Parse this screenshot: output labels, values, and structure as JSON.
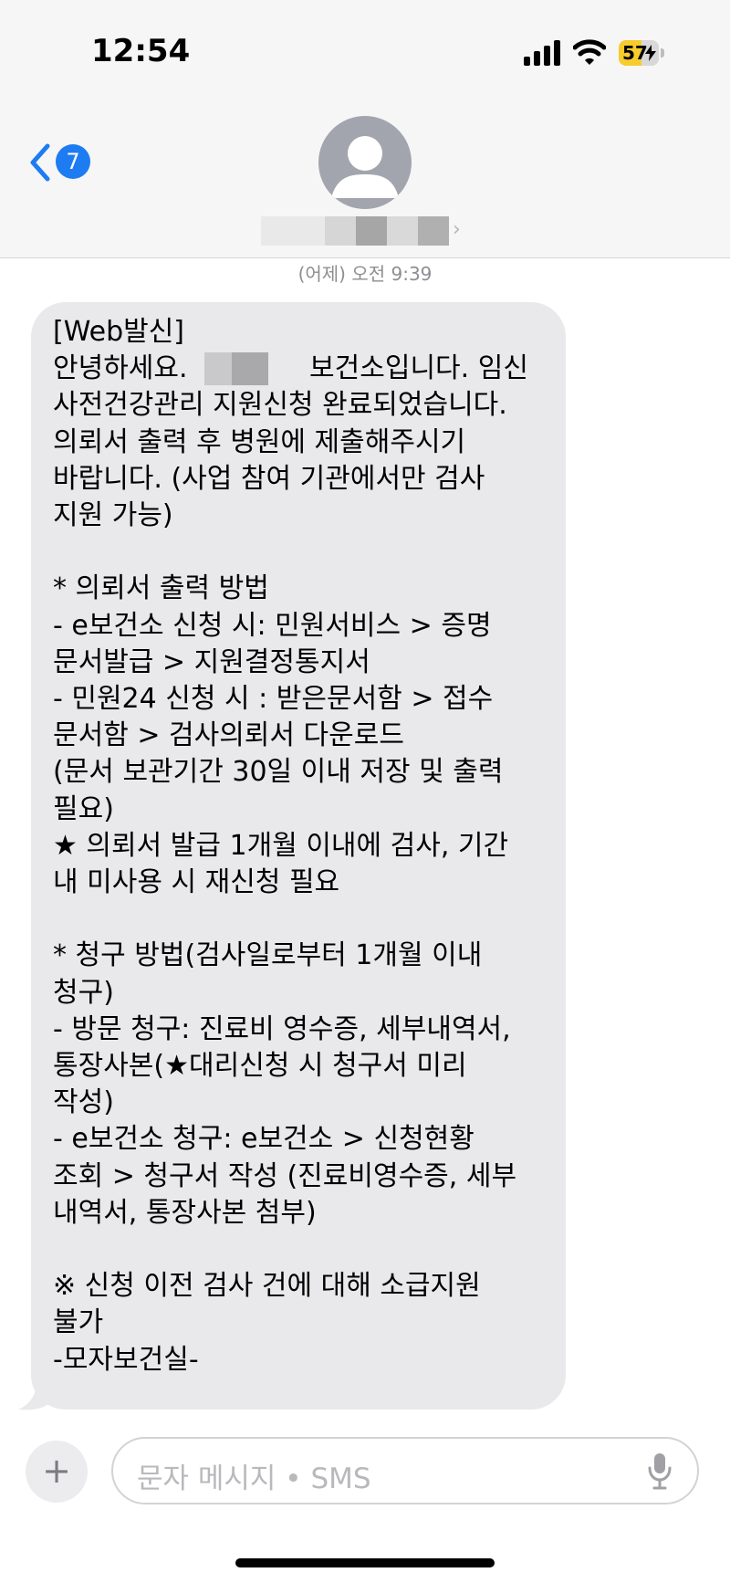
{
  "status_bar": {
    "time": "12:54",
    "battery_level": "57",
    "battery_fraction": 0.57,
    "battery_color": "#f7cc2d",
    "icons": [
      "signal-icon",
      "wifi-icon",
      "battery-charging-icon"
    ]
  },
  "header": {
    "back_badge_count": "7",
    "accent_color": "#1e7cf2",
    "avatar_icon": "person-silhouette-icon"
  },
  "conversation": {
    "timestamp": "(어제) 오전 9:39",
    "message_lines": [
      "[Web발신]",
      "안녕하세요.              보건소입니다. 임신",
      "사전건강관리 지원신청 완료되었습니다.",
      "의뢰서 출력 후 병원에 제출해주시기",
      "바랍니다. (사업 참여 기관에서만 검사",
      "지원 가능)",
      "",
      "* 의뢰서 출력 방법",
      "- e보건소 신청 시: 민원서비스 > 증명",
      "문서발급 > 지원결정통지서",
      "- 민원24 신청 시 : 받은문서함 > 접수",
      "문서함 > 검사의뢰서 다운로드",
      "(문서 보관기간 30일 이내 저장 및 출력",
      "필요)",
      "★ 의뢰서 발급 1개월 이내에 검사, 기간",
      "내 미사용 시 재신청 필요",
      "",
      "* 청구 방법(검사일로부터 1개월 이내",
      "청구)",
      "- 방문 청구: 진료비 영수증, 세부내역서,",
      "통장사본(★대리신청 시 청구서 미리",
      "작성)",
      "- e보건소 청구: e보건소 > 신청현황",
      "조회 > 청구서 작성 (진료비영수증, 세부",
      "내역서, 통장사본 첨부)",
      "",
      "※ 신청 이전 검사 건에 대해 소급지원",
      "불가",
      "-모자보건실-"
    ],
    "bubble_color": "#e9e9eb"
  },
  "compose": {
    "placeholder": "문자 메시지 • SMS",
    "add_icon": "plus-icon",
    "mic_icon": "microphone-icon"
  }
}
